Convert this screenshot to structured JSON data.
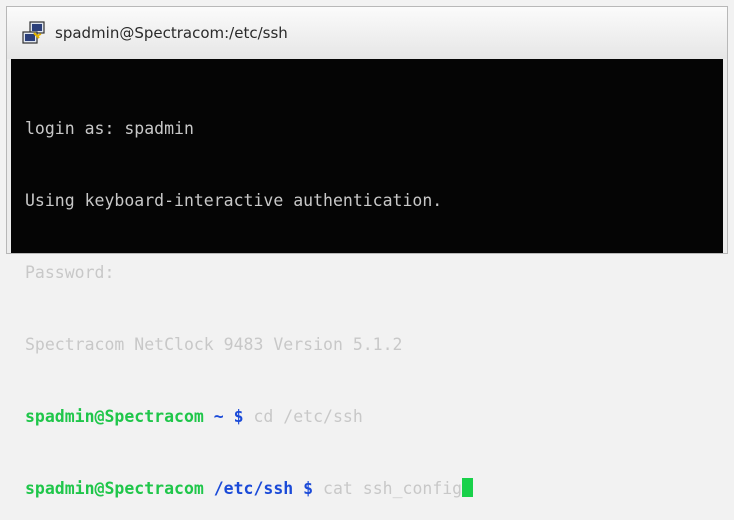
{
  "window": {
    "title": "spadmin@Spectracom:/etc/ssh",
    "icon": "putty-icon"
  },
  "terminal": {
    "lines": [
      "login as: spadmin",
      "Using keyboard-interactive authentication.",
      "Password:",
      "Spectracom NetClock 9483 Version 5.1.2"
    ],
    "prompts": [
      {
        "user": "spadmin@Spectracom",
        "path": "~",
        "symbol": "$",
        "command": "cd /etc/ssh"
      },
      {
        "user": "spadmin@Spectracom",
        "path": "/etc/ssh",
        "symbol": "$",
        "command": "cat ssh_config"
      }
    ]
  },
  "colors": {
    "background": "#050505",
    "text": "#c8c8c8",
    "prompt_user": "#1fc64a",
    "prompt_path": "#1a4ad8",
    "cursor": "#19d14a"
  }
}
